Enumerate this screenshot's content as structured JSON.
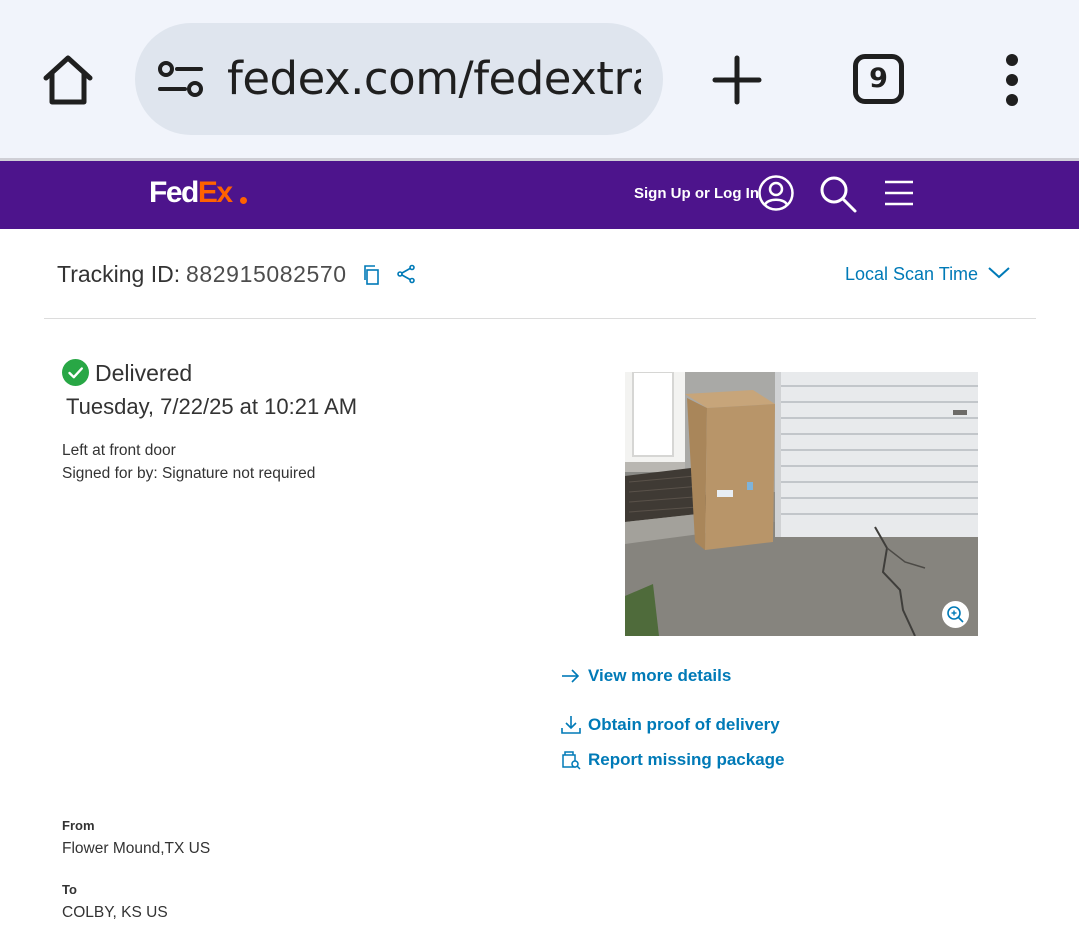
{
  "browser": {
    "url": "fedex.com/fedextrack",
    "tab_count": "9"
  },
  "header": {
    "logo_fed": "Fed",
    "logo_ex": "Ex",
    "signup_label": "Sign Up or Log In",
    "brand_color": "#4d148c",
    "accent_color": "#ff6200"
  },
  "tracking": {
    "label": "Tracking ID:",
    "id": "882915082570",
    "scan_time_label": "Local Scan Time"
  },
  "status": {
    "title": "Delivered",
    "date": "Tuesday, 7/22/25 at 10:21 AM",
    "note": "Left at front door",
    "signature": "Signed for by: Signature not required",
    "status_color": "#28a745"
  },
  "actions": {
    "view_details": "View more details",
    "proof_of_delivery": "Obtain proof of delivery",
    "report_missing": "Report missing package",
    "link_color": "#007ab7"
  },
  "shipment": {
    "from_label": "From",
    "from_value": "Flower Mound,TX US",
    "to_label": "To",
    "to_value": "COLBY, KS US"
  }
}
